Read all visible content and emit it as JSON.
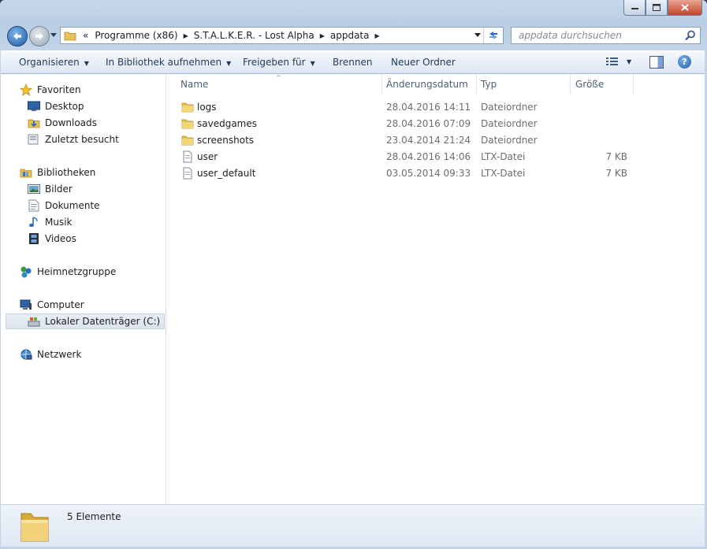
{
  "window": {
    "caption_buttons": [
      "minimize",
      "maximize",
      "close"
    ]
  },
  "nav": {
    "address_overflow": "«",
    "breadcrumbs": [
      {
        "label": "Programme (x86)"
      },
      {
        "label": "S.T.A.L.K.E.R. - Lost Alpha"
      },
      {
        "label": "appdata"
      }
    ],
    "search_placeholder": "appdata durchsuchen"
  },
  "toolbar": {
    "organize": "Organisieren",
    "include_library": "In Bibliothek aufnehmen",
    "share": "Freigeben für",
    "burn": "Brennen",
    "new_folder": "Neuer Ordner"
  },
  "sidebar": {
    "favorites": {
      "label": "Favoriten",
      "items": [
        {
          "label": "Desktop",
          "icon": "desktop-icon"
        },
        {
          "label": "Downloads",
          "icon": "downloads-icon"
        },
        {
          "label": "Zuletzt besucht",
          "icon": "recent-places-icon"
        }
      ]
    },
    "libraries": {
      "label": "Bibliotheken",
      "items": [
        {
          "label": "Bilder",
          "icon": "pictures-icon"
        },
        {
          "label": "Dokumente",
          "icon": "documents-icon"
        },
        {
          "label": "Musik",
          "icon": "music-icon"
        },
        {
          "label": "Videos",
          "icon": "videos-icon"
        }
      ]
    },
    "homegroup": {
      "label": "Heimnetzgruppe"
    },
    "computer": {
      "label": "Computer",
      "items": [
        {
          "label": "Lokaler Datenträger (C:)",
          "icon": "local-disk-icon",
          "selected": true
        }
      ]
    },
    "network": {
      "label": "Netzwerk"
    }
  },
  "columns": {
    "name": "Name",
    "date": "Änderungsdatum",
    "type": "Typ",
    "size": "Größe"
  },
  "files": [
    {
      "name": "logs",
      "date": "28.04.2016 14:11",
      "type": "Dateiordner",
      "size": "",
      "icon": "folder-icon"
    },
    {
      "name": "savedgames",
      "date": "28.04.2016 07:09",
      "type": "Dateiordner",
      "size": "",
      "icon": "folder-icon"
    },
    {
      "name": "screenshots",
      "date": "23.04.2014 21:24",
      "type": "Dateiordner",
      "size": "",
      "icon": "folder-icon"
    },
    {
      "name": "user",
      "date": "28.04.2016 14:06",
      "type": "LTX-Datei",
      "size": "7 KB",
      "icon": "file-icon"
    },
    {
      "name": "user_default",
      "date": "03.05.2014 09:33",
      "type": "LTX-Datei",
      "size": "7 KB",
      "icon": "file-icon"
    }
  ],
  "status": {
    "count": "5 Elemente"
  },
  "colors": {
    "accent": "#1e395b",
    "folder": "#e8c15a",
    "selection": "#dbe3ec"
  }
}
